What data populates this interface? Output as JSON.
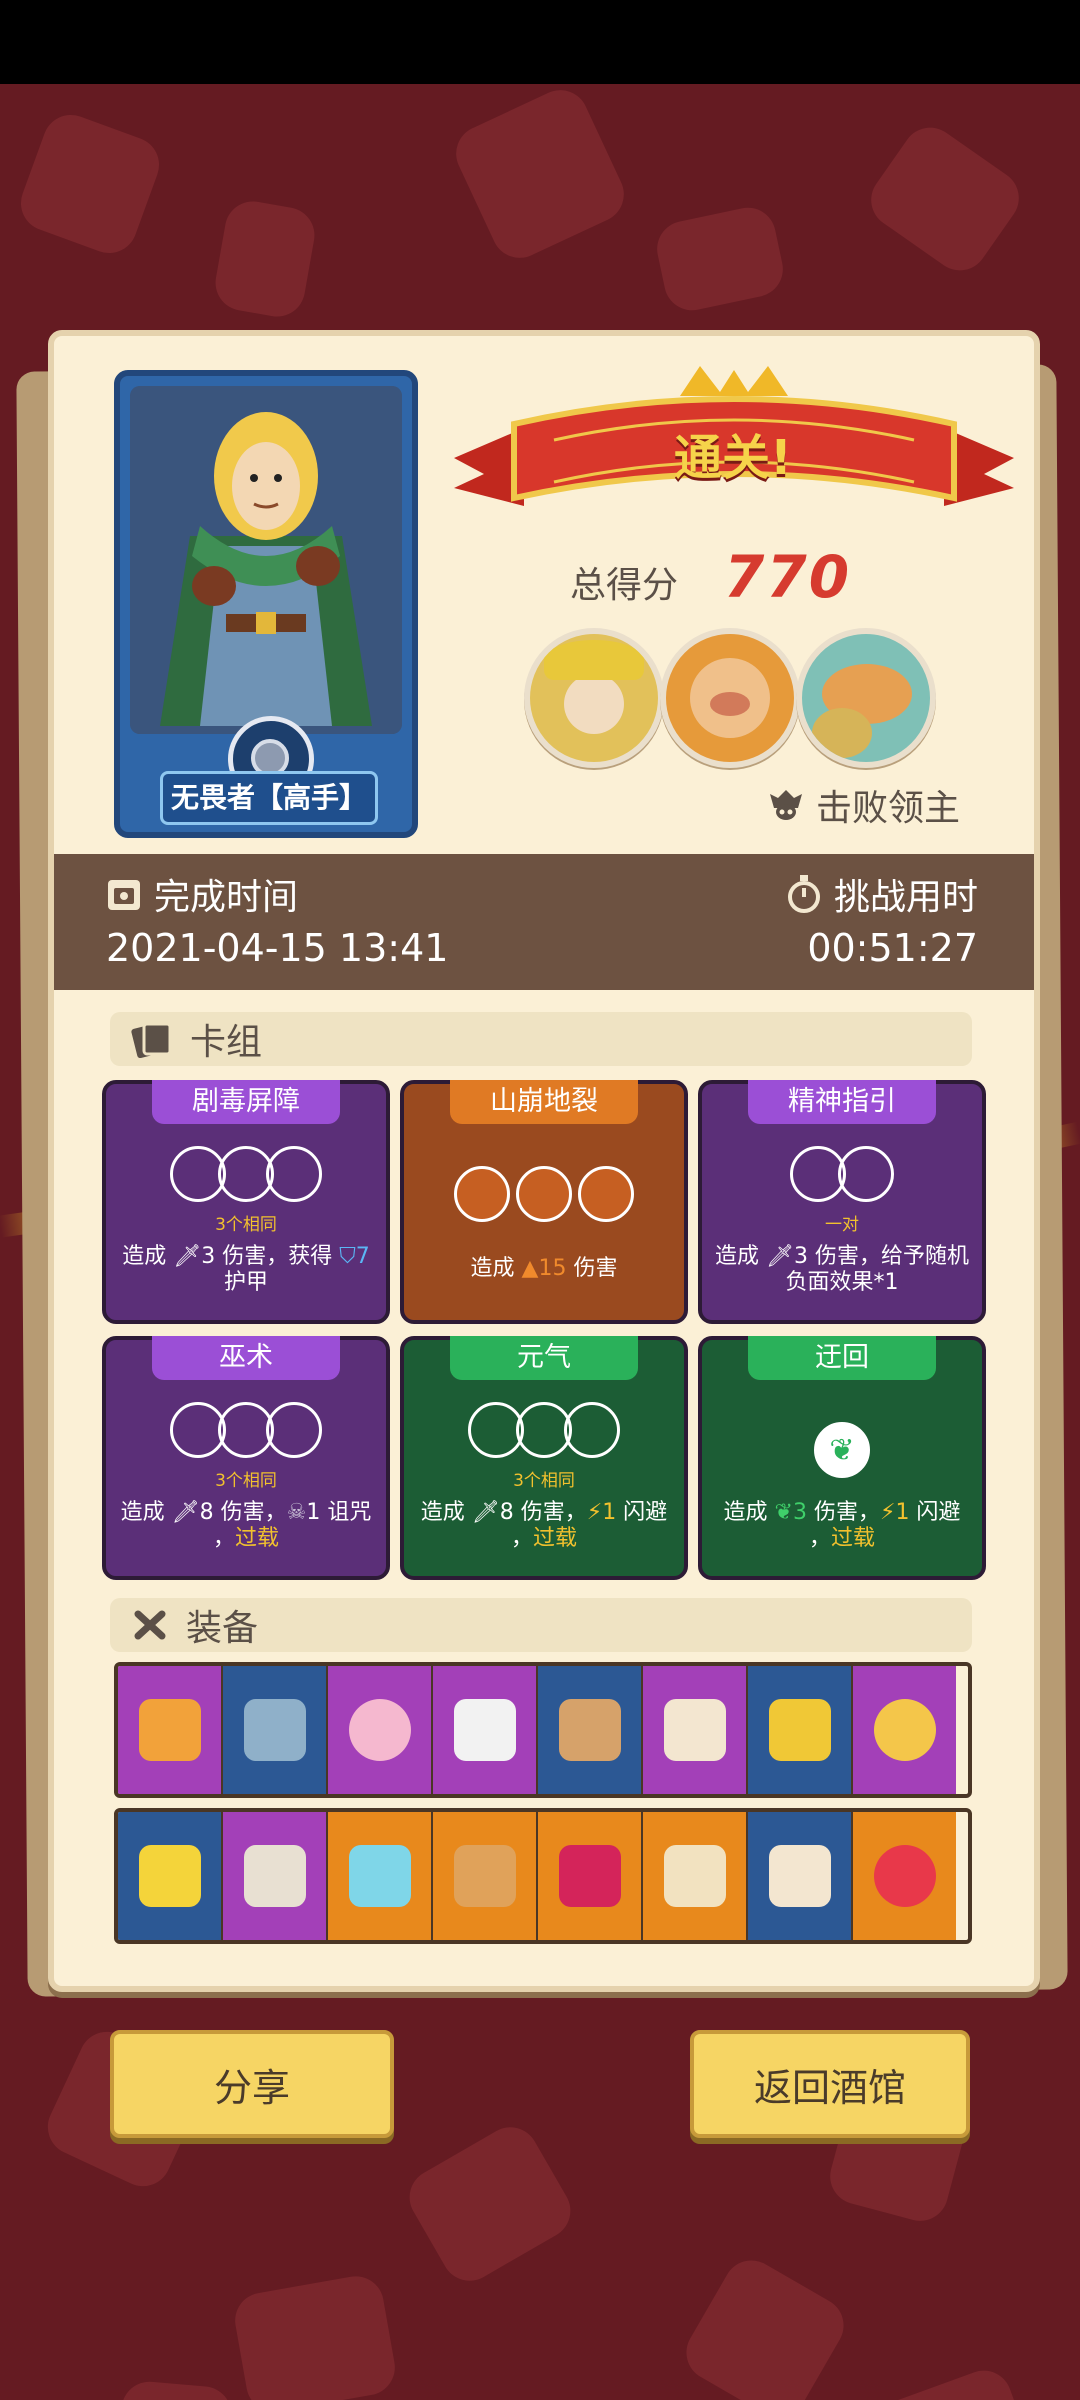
{
  "character": {
    "title": "无畏者【高手】"
  },
  "result": {
    "banner": "通关!",
    "score_label": "总得分",
    "score_value": "770",
    "defeated_label": "击败领主"
  },
  "time": {
    "complete_label": "完成时间",
    "complete_value": "2021-04-15 13:41",
    "duration_label": "挑战用时",
    "duration_value": "00:51:27"
  },
  "deck": {
    "title": "卡组",
    "cards": [
      {
        "name": "剧毒屏障",
        "condition": "3个相同",
        "desc_parts": [
          "造成 ",
          "3",
          " 伤害，获得 ",
          "7",
          " 护甲"
        ]
      },
      {
        "name": "山崩地裂",
        "condition": "",
        "desc_parts": [
          "造成 ",
          "15",
          " 伤害"
        ]
      },
      {
        "name": "精神指引",
        "condition": "一对",
        "desc_parts": [
          "造成 ",
          "3",
          " 伤害，给予随机负面效果*1"
        ]
      },
      {
        "name": "巫术",
        "condition": "3个相同",
        "desc_parts": [
          "造成 ",
          "8",
          " 伤害，",
          "1",
          " 诅咒",
          "，",
          "过载"
        ]
      },
      {
        "name": "元气",
        "condition": "3个相同",
        "desc_parts": [
          "造成 ",
          "8",
          " 伤害，",
          "1",
          " 闪避",
          "，",
          "过载"
        ]
      },
      {
        "name": "迂回",
        "condition": "",
        "desc_parts": [
          "造成 ",
          "3",
          " 伤害，",
          "1",
          " 闪避",
          "，",
          "过载"
        ]
      }
    ]
  },
  "equipment": {
    "title": "装备"
  },
  "buttons": {
    "share": "分享",
    "back": "返回酒馆"
  },
  "colors": {
    "accent_red": "#d63b2f",
    "panel": "#fbf0d6",
    "time_band": "#6d5241"
  }
}
